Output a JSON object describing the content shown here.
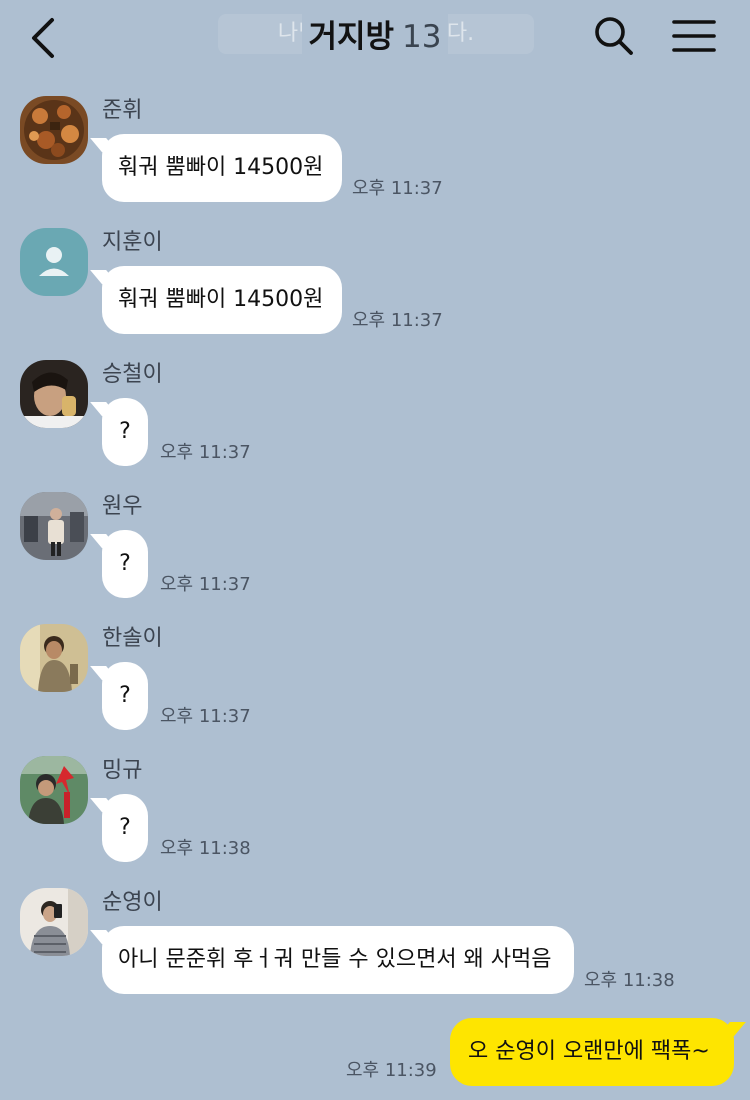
{
  "header": {
    "title": "거지방",
    "member_count": "13",
    "notice_text": "나님이 초대했습니다."
  },
  "messages": [
    {
      "sender": "준휘",
      "text": "훠궈 뿜빠이 14500원",
      "time": "오후 11:37"
    },
    {
      "sender": "지훈이",
      "text": "훠궈 뿜빠이 14500원",
      "time": "오후 11:37"
    },
    {
      "sender": "승철이",
      "text": "?",
      "time": "오후 11:37"
    },
    {
      "sender": "원우",
      "text": "?",
      "time": "오후 11:37"
    },
    {
      "sender": "한솔이",
      "text": "?",
      "time": "오후 11:37"
    },
    {
      "sender": "밍규",
      "text": "?",
      "time": "오후 11:38"
    },
    {
      "sender": "순영이",
      "text": "아니 문준휘 후ㅓ궈 만들 수 있으면서 왜 사먹음",
      "time": "오후 11:38"
    }
  ],
  "my_message": {
    "text": "오 순영이 오랜만에 팩폭~",
    "time": "오후 11:39"
  },
  "colors": {
    "background": "#aebfd1",
    "incoming_bubble": "#ffffff",
    "outgoing_bubble": "#fee500"
  }
}
